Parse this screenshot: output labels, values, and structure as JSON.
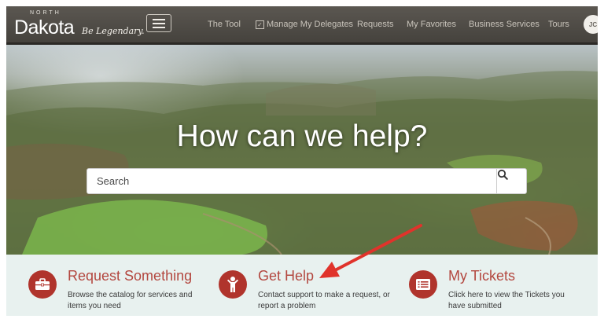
{
  "header": {
    "logo": {
      "north": "NORTH",
      "dakota": "Dakota",
      "tagline": "Be Legendary."
    },
    "nav": [
      {
        "label": "The Tool"
      },
      {
        "label": "Manage My Delegates",
        "checked": true
      },
      {
        "label": "Requests"
      },
      {
        "label": "My Favorites"
      },
      {
        "label": "Business Services"
      },
      {
        "label": "Tours"
      }
    ],
    "avatar_initials": "JC"
  },
  "hero": {
    "title": "How can we help?",
    "search_placeholder": "Search"
  },
  "cards": [
    {
      "title": "Request Something",
      "description": "Browse the catalog for services and items you need",
      "icon": "briefcase-icon"
    },
    {
      "title": "Get Help",
      "description": "Contact support to make a request, or report a problem",
      "icon": "person-help-icon"
    },
    {
      "title": "My Tickets",
      "description": "Click here to view the Tickets you have submitted",
      "icon": "ticket-list-icon"
    }
  ],
  "colors": {
    "accent": "#b0342c",
    "accent_text": "#b3473f",
    "annotation_arrow": "#e0332b",
    "nav_bg": "#4f4b46"
  }
}
